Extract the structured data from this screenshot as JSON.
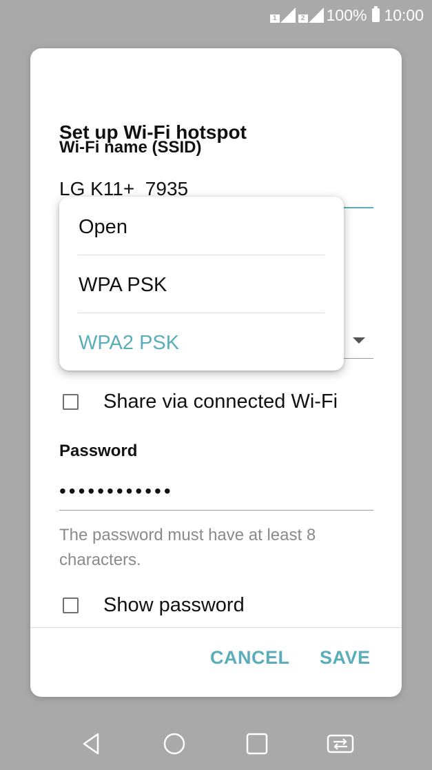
{
  "status_bar": {
    "sim1": "1",
    "sim2": "2",
    "battery": "100%",
    "time": "10:00"
  },
  "dialog": {
    "title": "Set up Wi-Fi hotspot",
    "ssid_label": "Wi-Fi name (SSID)",
    "ssid_value": "LG K11+_7935",
    "share_label": "Share via connected Wi-Fi",
    "share_checked": false,
    "password_label": "Password",
    "password_value": "••••••••••••",
    "password_helper": "The password must have at least 8 characters.",
    "show_password_label": "Show password",
    "show_password_checked": false,
    "cancel_label": "CANCEL",
    "save_label": "SAVE",
    "accent_color": "#5aaeb9"
  },
  "security_menu": {
    "options": [
      "Open",
      "WPA PSK",
      "WPA2 PSK"
    ],
    "selected": "WPA2 PSK"
  },
  "nav_bar": {
    "icons": [
      "back-icon",
      "home-icon",
      "recents-icon",
      "dual-window-icon"
    ]
  }
}
